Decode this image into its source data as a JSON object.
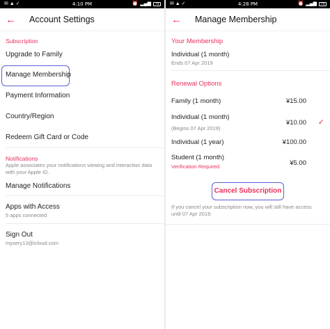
{
  "left": {
    "status": {
      "time": "4:10 PM",
      "battery": "79"
    },
    "title": "Account Settings",
    "subscription_header": "Subscription",
    "upgrade": "Upgrade to Family",
    "manage_membership": "Manage Membership",
    "payment": "Payment Information",
    "country": "Country/Region",
    "redeem": "Redeem Gift Card or Code",
    "notifications_header": "Notifications",
    "notifications_desc": "Apple associates your notifications viewing and interaction data with your Apple ID.",
    "manage_notifications": "Manage Notifications",
    "apps_access": "Apps with Access",
    "apps_count": "5 apps connected",
    "sign_out": "Sign Out",
    "email": "mysery13@icloud.com"
  },
  "right": {
    "status": {
      "time": "4:28 PM",
      "battery": "79"
    },
    "title": "Manage Membership",
    "your_membership_header": "Your Membership",
    "current_plan": "Individual (1 month)",
    "ends": "Ends 07 Apr 2019",
    "renewal_header": "Renewal Options",
    "options": [
      {
        "name": "Family (1 month)",
        "price": "¥15.00"
      },
      {
        "name": "Individual (1 month)",
        "price": "¥10.00",
        "note": "(Begins 07 Apr 2019)",
        "selected": true
      },
      {
        "name": "Individual  (1 year)",
        "price": "¥100.00"
      },
      {
        "name": "Student (1 month)",
        "price": "¥5.00",
        "note": "Verification Required"
      }
    ],
    "cancel_label": "Cancel Subscription",
    "cancel_note": "If you cancel your subscription now, you will still have access until 07 Apr 2019."
  },
  "colors": {
    "accent": "#e8305a",
    "highlight": "#5a5fd6"
  }
}
